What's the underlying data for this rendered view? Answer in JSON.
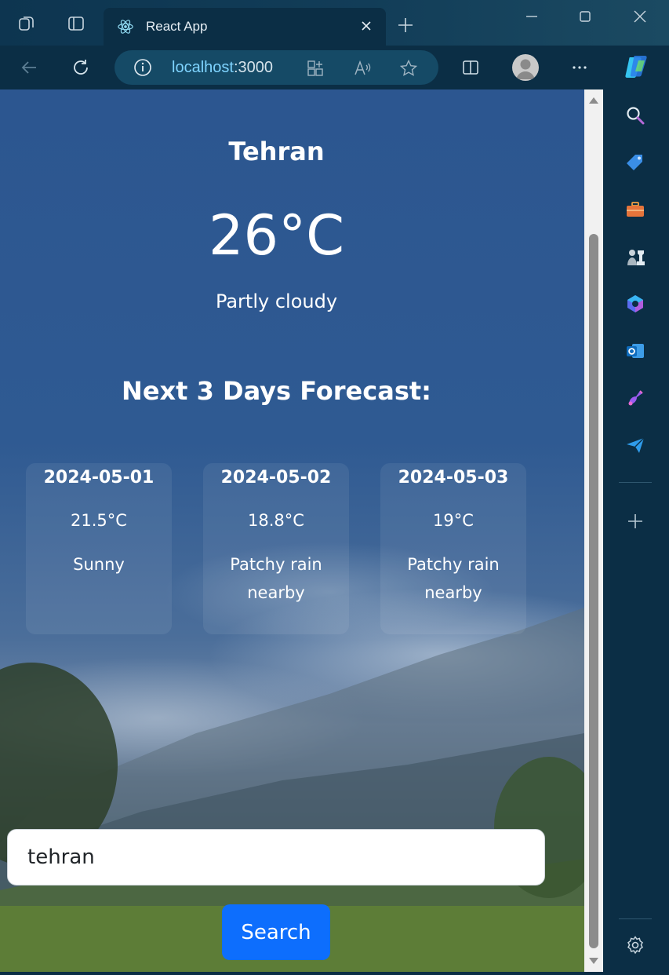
{
  "browser": {
    "tab": {
      "title": "React App",
      "favicon": "react-atom-icon"
    },
    "address": {
      "host": "localhost",
      "port": ":3000"
    },
    "window_controls": [
      "minimize-icon",
      "maximize-icon",
      "close-icon"
    ],
    "toolbar_icons": [
      "back-icon",
      "refresh-icon",
      "info-icon",
      "app-grid-icon",
      "read-aloud-icon",
      "favorite-star-icon",
      "split-screen-icon",
      "profile-avatar",
      "more-icon",
      "copilot-icon"
    ],
    "sidebar_icons": [
      "search-icon",
      "shopping-tag-icon",
      "tools-icon",
      "games-icon",
      "microsoft365-icon",
      "outlook-icon",
      "designer-icon",
      "send-icon",
      "add-icon",
      "settings-icon"
    ]
  },
  "weather": {
    "city": "Tehran",
    "temperature": "26°C",
    "condition": "Partly cloudy"
  },
  "forecast": {
    "heading": "Next 3 Days Forecast:",
    "days": [
      {
        "date": "2024-05-01",
        "temp": "21.5°C",
        "condition": "Sunny"
      },
      {
        "date": "2024-05-02",
        "temp": "18.8°C",
        "condition": "Patchy rain nearby"
      },
      {
        "date": "2024-05-03",
        "temp": "19°C",
        "condition": "Patchy rain nearby"
      }
    ]
  },
  "search": {
    "value": "tehran",
    "button_label": "Search"
  },
  "colors": {
    "primary_button": "#0d6efd",
    "browser_chrome": "#0b2e45",
    "url_host": "#7fd4ff"
  }
}
